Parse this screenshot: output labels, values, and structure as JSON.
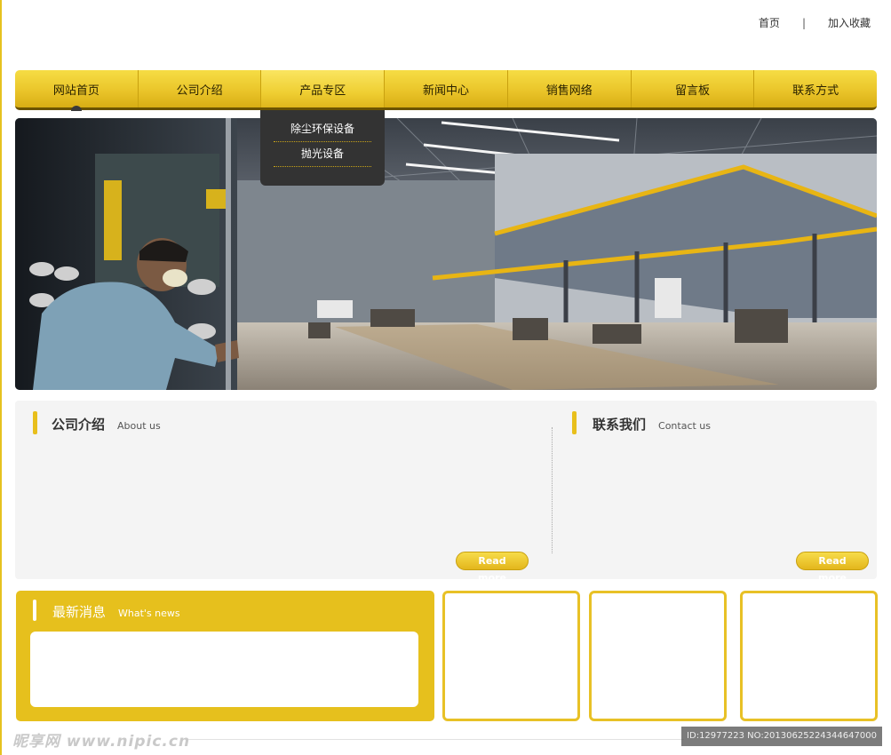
{
  "top_links": {
    "home": "首页",
    "separator": "|",
    "bookmark": "加入收藏"
  },
  "nav": {
    "items": [
      {
        "label": "网站首页"
      },
      {
        "label": "公司介绍"
      },
      {
        "label": "产品专区"
      },
      {
        "label": "新闻中心"
      },
      {
        "label": "销售网络"
      },
      {
        "label": "留言板"
      },
      {
        "label": "联系方式"
      }
    ],
    "dropdown": [
      "除尘环保设备",
      "抛光设备"
    ]
  },
  "about": {
    "title": "公司介绍",
    "subtitle": "About us",
    "read_more": "Read more"
  },
  "contact": {
    "title": "联系我们",
    "subtitle": "Contact us",
    "read_more": "Read more"
  },
  "news": {
    "title": "最新消息",
    "subtitle": "What's news"
  },
  "watermark": {
    "site": "昵享网 www.nipic.cn",
    "id": "ID:12977223 NO:20130625224344647000"
  },
  "colors": {
    "accent": "#e6c01d",
    "dropdown_bg": "#333333",
    "panel_bg": "#f4f4f4"
  }
}
